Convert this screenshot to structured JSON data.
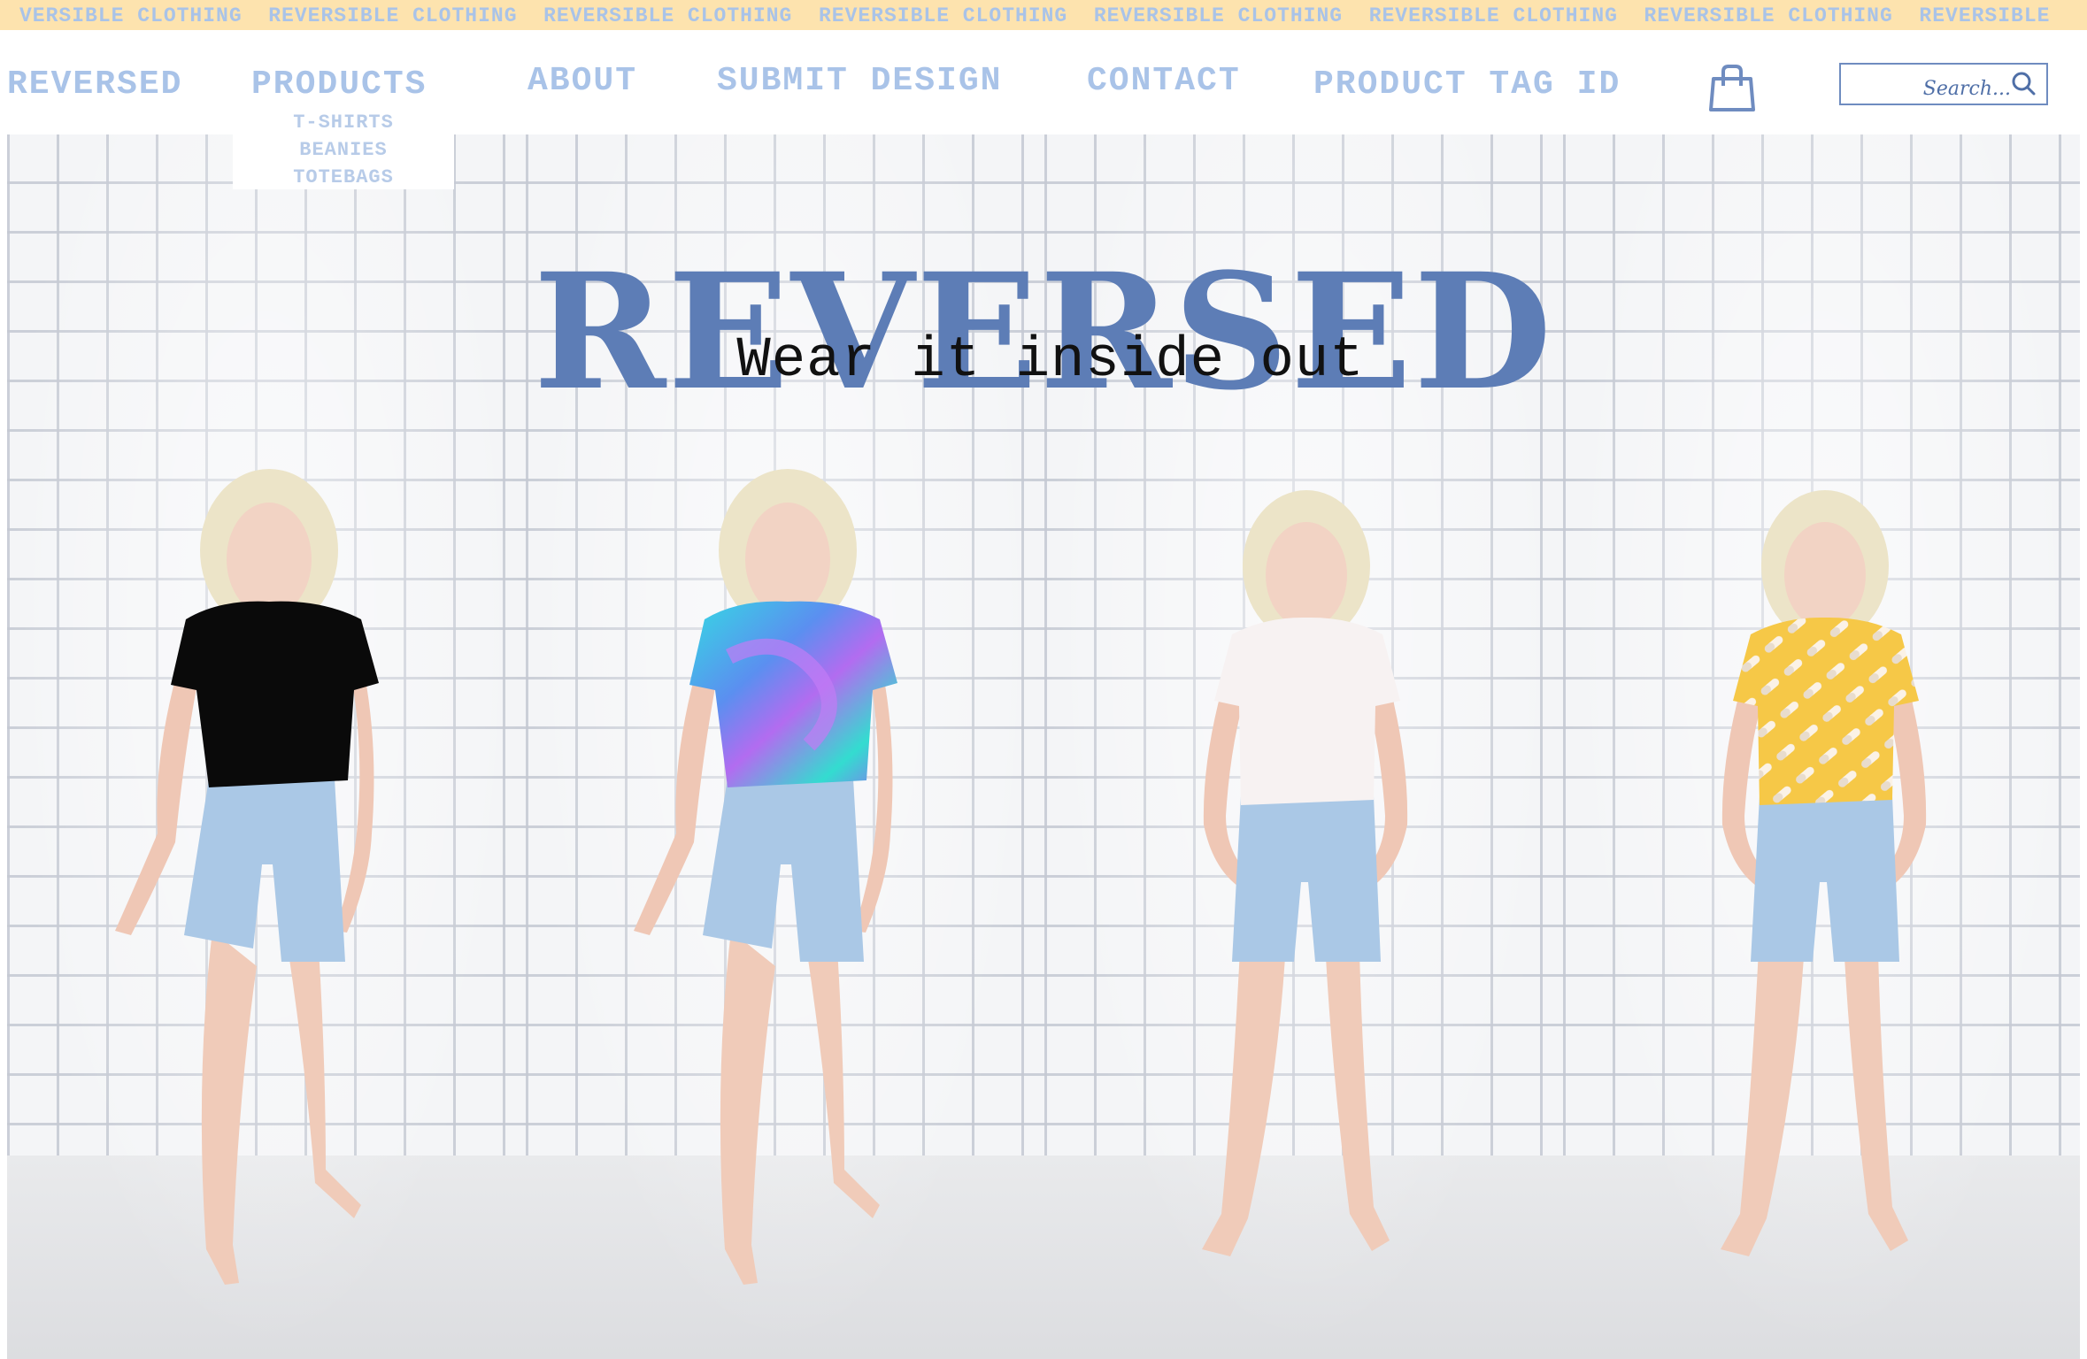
{
  "marquee": {
    "items": [
      "VERSIBLE CLOTHING",
      "REVERSIBLE CLOTHING",
      "REVERSIBLE CLOTHING",
      "REVERSIBLE CLOTHING",
      "REVERSIBLE CLOTHING",
      "REVERSIBLE CLOTHING",
      "REVERSIBLE CLOTHING",
      "REVERSIBLE"
    ]
  },
  "nav": {
    "brand": "REVERSED",
    "products": "PRODUCTS",
    "about": "ABOUT",
    "submit_design": "SUBMIT DESIGN",
    "contact": "CONTACT",
    "product_tag_id": "PRODUCT TAG ID",
    "cart_icon": "shopping-bag-icon",
    "search": {
      "placeholder": "Search...",
      "icon": "search-icon"
    },
    "products_menu": [
      "T-SHIRTS",
      "BEANIES",
      "TOTEBAGS"
    ]
  },
  "hero": {
    "title": "REVERSED",
    "tagline": "Wear it inside out",
    "models": [
      {
        "shirt": "black",
        "shirt_color": "#0a0a0a"
      },
      {
        "shirt": "holographic",
        "shirt_color": "#3fd6e0"
      },
      {
        "shirt": "white",
        "shirt_color": "#f7f2f2"
      },
      {
        "shirt": "yellow-pattern",
        "shirt_color": "#f6c847"
      }
    ]
  },
  "colors": {
    "accent": "#a9c3e8",
    "title_blue": "#5d7db6",
    "marquee_bg": "#fde3ae"
  }
}
